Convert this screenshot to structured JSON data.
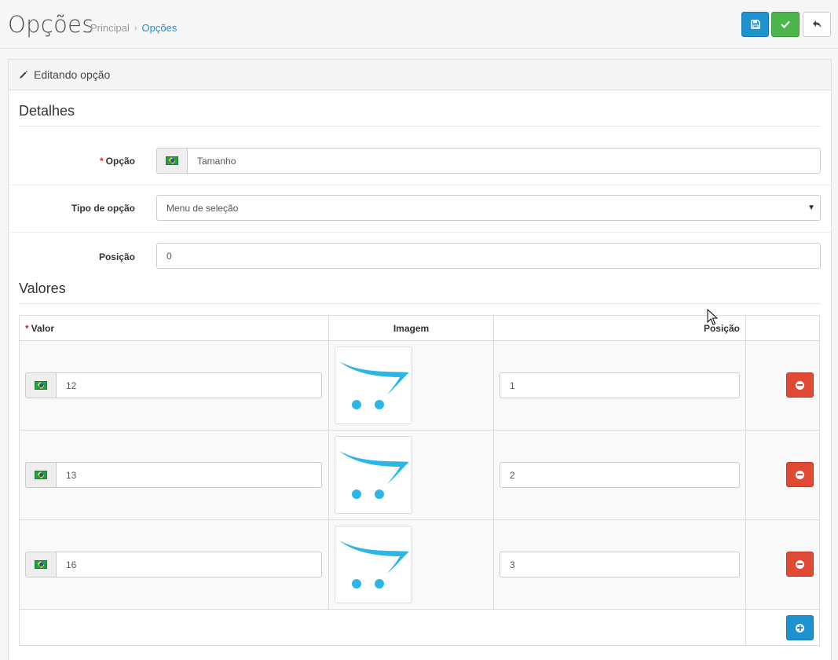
{
  "header": {
    "title": "Opções",
    "breadcrumb": [
      {
        "label": "Principal"
      },
      {
        "label": "Opções"
      }
    ],
    "breadcrumb_separator": "›"
  },
  "panel": {
    "heading": "Editando opção"
  },
  "details": {
    "legend": "Detalhes",
    "option_label": "Opção",
    "option_value": "Tamanho",
    "type_label": "Tipo de opção",
    "type_value": "Menu de seleção",
    "position_label": "Posição",
    "position_value": "0",
    "required_mark": "*"
  },
  "values": {
    "legend": "Valores",
    "columns": {
      "value": "Valor",
      "image": "Imagem",
      "position": "Posição"
    },
    "rows": [
      {
        "value": "12",
        "position": "1"
      },
      {
        "value": "13",
        "position": "2"
      },
      {
        "value": "16",
        "position": "3"
      }
    ]
  },
  "colors": {
    "primary": "#1e91cf",
    "success": "#4cb64c",
    "danger": "#e04a35",
    "cart_logo": "#2cb6e8"
  },
  "icons": {
    "save": "floppy-disk-icon",
    "apply": "check-icon",
    "back": "reply-arrow-icon",
    "heading": "pencil-icon",
    "remove": "minus-circle-icon",
    "add": "plus-circle-icon",
    "flag": "brazil-flag-icon",
    "thumbnail": "cart-logo-icon"
  }
}
